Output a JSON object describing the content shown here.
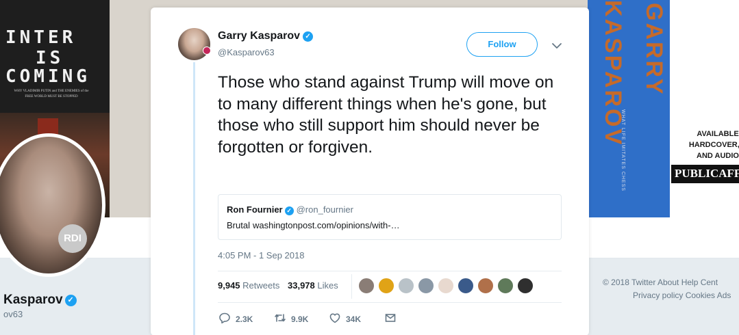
{
  "background": {
    "book_left": {
      "title_lines": [
        "INTER",
        "IS",
        "COMING"
      ],
      "subtitle": "WHY VLADIMIR PUTIN and THE ENEMIES of the FREE WORLD MUST BE STOPPED"
    },
    "book_right": {
      "title_vertical_1": "GARRY",
      "title_vertical_2": "KASPAROV",
      "spine_text": "WHAT LIFE IMITATES CHESS"
    },
    "promo": {
      "line1": "AVAILABLE",
      "line2": "HARDCOVER, E",
      "line3": "AND AUDIO",
      "publisher": "PUBLICAFF"
    },
    "profile": {
      "avatar_badge": "RDI",
      "name": "Kasparov",
      "handle": "ov63"
    },
    "footer": {
      "line1": "© 2018 Twitter   About   Help Cent",
      "line2": "Privacy policy   Cookies   Ads"
    }
  },
  "tweet": {
    "author": {
      "name": "Garry Kasparov",
      "handle": "@Kasparov63",
      "verified_icon": "✓"
    },
    "follow_label": "Follow",
    "text": "Those who stand against Trump will move on to many different things when he's gone, but those who still support him should never be forgotten or forgiven.",
    "quoted": {
      "name": "Ron Fournier",
      "handle": "@ron_fournier",
      "text": "Brutal",
      "link": "washingtonpost.com/opinions/with-…"
    },
    "timestamp": "4:05 PM - 1 Sep 2018",
    "stats": {
      "retweets_count": "9,945",
      "retweets_label": "Retweets",
      "likes_count": "33,978",
      "likes_label": "Likes"
    },
    "liker_colors": [
      "#8a7d76",
      "#e0a317",
      "#b9c2c8",
      "#8a98a6",
      "#e8d9cf",
      "#3a5a8a",
      "#b0704a",
      "#5f7a5a",
      "#2f2f2f"
    ],
    "actions": {
      "reply_count": "2.3K",
      "retweet_count": "9.9K",
      "like_count": "34K"
    }
  },
  "colors": {
    "accent": "#1da1f2",
    "muted": "#657786",
    "text": "#14171a"
  }
}
